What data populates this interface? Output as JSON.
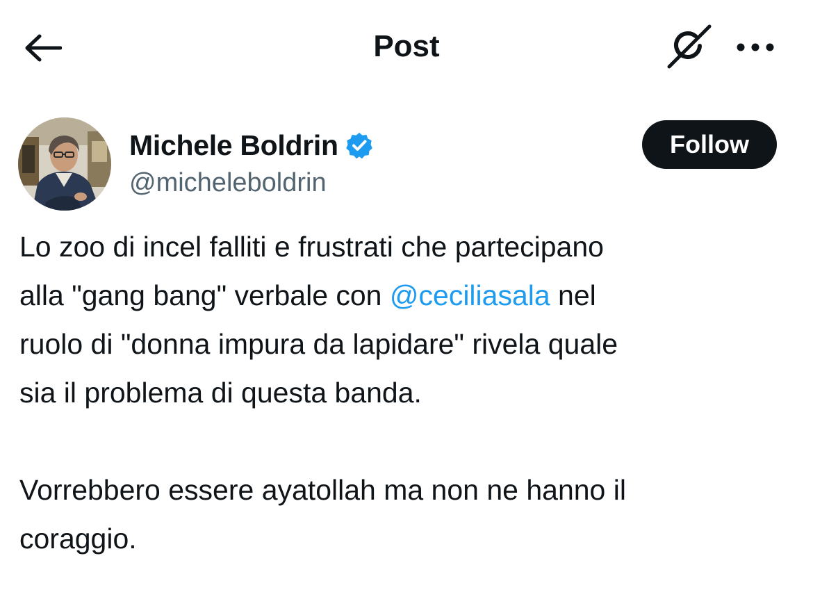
{
  "header": {
    "title": "Post",
    "back_icon": "arrow-left-icon",
    "grok_icon": "grok-icon",
    "more_icon": "more-horizontal-icon"
  },
  "author": {
    "name": "Michele Boldrin",
    "handle": "@micheleboldrin",
    "verified": true,
    "verified_color": "#1d9bf0",
    "avatar_icon": "avatar-photo"
  },
  "follow_button": {
    "label": "Follow",
    "background": "#0f1419"
  },
  "tweet": {
    "line_1": "Lo zoo di incel falliti e frustrati che partecipano",
    "line_2_before": "alla \"gang bang\" verbale con ",
    "mention": "@ceciliasala",
    "line_2_after": " nel",
    "line_3": "ruolo di \"donna impura da lapidare\" rivela quale",
    "line_4": "sia il problema di questa banda.",
    "line_5": "Vorrebbero essere ayatollah ma non ne hanno il",
    "line_6": "coraggio."
  },
  "colors": {
    "text": "#0f1419",
    "secondary_text": "#536471",
    "link": "#1d9bf0"
  }
}
